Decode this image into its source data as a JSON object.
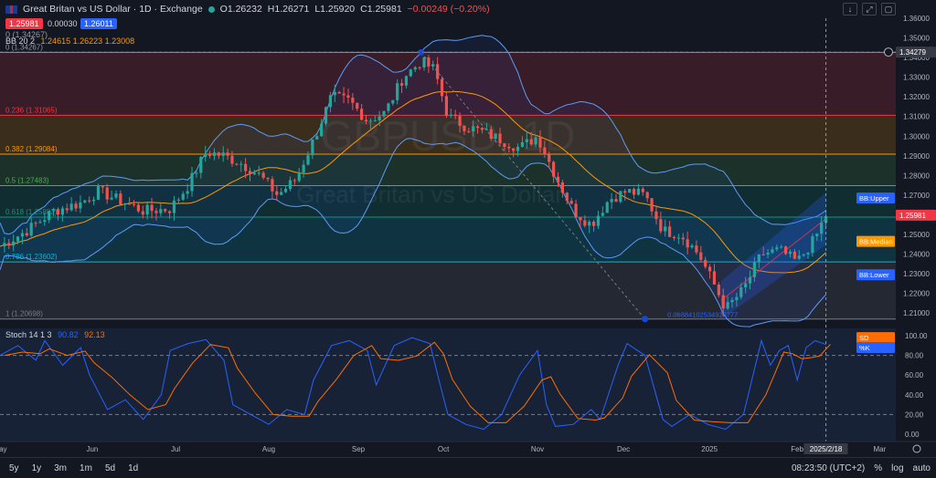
{
  "header": {
    "symbol_title": "Great Britan vs US Dollar · 1D · Exchange",
    "open": "O1.26232",
    "high": "H1.26271",
    "low": "L1.25920",
    "close": "C1.25981",
    "change": "−0.00249 (−0.20%)",
    "bid": "1.25981",
    "spread": "0.00030",
    "ask": "1.26011"
  },
  "indicators": {
    "fib_top": "0 (1.34267)",
    "bb": "BB 20 2",
    "bb_values": "1.24615  1.26223  1.23008",
    "stoch": "Stoch 14 1 3",
    "stoch_k": "90.82",
    "stoch_d": "92.13"
  },
  "watermark": {
    "symbol": "GBPUSD, 1D",
    "name": "Great Britan vs US Dollar"
  },
  "bottom": {
    "ranges": [
      "5y",
      "1y",
      "3m",
      "1m",
      "5d",
      "1d"
    ],
    "time": "08:23:50 (UTC+2)",
    "pct": "%",
    "log": "log",
    "auto": "auto"
  },
  "colors": {
    "up": "#26a69a",
    "down": "#ef5350",
    "bb_band": "#5b9cf6",
    "bb_mid": "#ff9800",
    "stoch_k": "#2962ff",
    "stoch_d": "#ff6d00"
  },
  "chart_data": {
    "type": "candlestick",
    "price_axis": {
      "ticks": [
        "1.36000",
        "1.35000",
        "1.34000",
        "1.33000",
        "1.32000",
        "1.31000",
        "1.30000",
        "1.29000",
        "1.28000",
        "1.27000",
        "1.26000",
        "1.25000",
        "1.24000",
        "1.23000",
        "1.22000",
        "1.21000"
      ],
      "ylim": [
        1.205,
        1.36
      ]
    },
    "stoch_axis": {
      "ticks": [
        "100.00",
        "80.00",
        "60.00",
        "40.00",
        "20.00",
        "0.00"
      ],
      "ylim": [
        0,
        100
      ]
    },
    "time_axis": {
      "ticks": [
        "May",
        "Jun",
        "Jul",
        "Aug",
        "Sep",
        "Oct",
        "Nov",
        "Dec",
        "2025",
        "Feb",
        "Mar"
      ],
      "cursor_label": "2025/2/18"
    },
    "price_labels": {
      "current": "1.25981",
      "cursor": "1.34279",
      "bb_upper": "BB:Upper",
      "bb_median": "BB:Median",
      "bb_lower": "BB:Lower",
      "sd": "SD",
      "k": "%K"
    },
    "fib_levels": [
      {
        "label": "0 (1.34267)",
        "value": 1.34267,
        "color": "#9598a1"
      },
      {
        "label": "0.236 (1.31065)",
        "value": 1.31065,
        "color": "#f23645"
      },
      {
        "label": "0.382 (1.29084)",
        "value": 1.29084,
        "color": "#ff9800"
      },
      {
        "label": "0.5 (1.27483)",
        "value": 1.27483,
        "color": "#4caf50"
      },
      {
        "label": "0.618 (1.25882)",
        "value": 1.25882,
        "color": "#089981"
      },
      {
        "label": "0.786 (1.23602)",
        "value": 1.23602,
        "color": "#00bcd4"
      },
      {
        "label": "1 (1.20698)",
        "value": 1.20698,
        "color": "#787b86"
      }
    ],
    "trend_line_label": "0.06884102534923777",
    "channel": {
      "start": [
        0.805,
        1.226,
        1.207
      ],
      "end": [
        0.922,
        1.271,
        1.245
      ]
    },
    "close_path": [
      [
        0.0,
        1.244
      ],
      [
        0.03,
        1.252
      ],
      [
        0.06,
        1.262
      ],
      [
        0.09,
        1.266
      ],
      [
        0.11,
        1.272
      ],
      [
        0.13,
        1.268
      ],
      [
        0.16,
        1.262
      ],
      [
        0.19,
        1.263
      ],
      [
        0.21,
        1.275
      ],
      [
        0.23,
        1.292
      ],
      [
        0.25,
        1.29
      ],
      [
        0.27,
        1.286
      ],
      [
        0.29,
        1.28
      ],
      [
        0.31,
        1.27
      ],
      [
        0.33,
        1.278
      ],
      [
        0.35,
        1.298
      ],
      [
        0.37,
        1.32
      ],
      [
        0.39,
        1.318
      ],
      [
        0.41,
        1.308
      ],
      [
        0.43,
        1.312
      ],
      [
        0.45,
        1.33
      ],
      [
        0.47,
        1.338
      ],
      [
        0.485,
        1.334
      ],
      [
        0.5,
        1.31
      ],
      [
        0.52,
        1.305
      ],
      [
        0.54,
        1.302
      ],
      [
        0.56,
        1.298
      ],
      [
        0.58,
        1.294
      ],
      [
        0.6,
        1.3
      ],
      [
        0.62,
        1.28
      ],
      [
        0.64,
        1.262
      ],
      [
        0.66,
        1.255
      ],
      [
        0.68,
        1.268
      ],
      [
        0.7,
        1.272
      ],
      [
        0.72,
        1.27
      ],
      [
        0.74,
        1.252
      ],
      [
        0.76,
        1.25
      ],
      [
        0.78,
        1.24
      ],
      [
        0.8,
        1.222
      ],
      [
        0.81,
        1.212
      ],
      [
        0.83,
        1.222
      ],
      [
        0.85,
        1.24
      ],
      [
        0.87,
        1.242
      ],
      [
        0.89,
        1.236
      ],
      [
        0.91,
        1.248
      ],
      [
        0.922,
        1.26
      ]
    ],
    "stoch_path": [
      [
        0.0,
        80
      ],
      [
        0.02,
        90
      ],
      [
        0.04,
        75
      ],
      [
        0.05,
        95
      ],
      [
        0.07,
        70
      ],
      [
        0.09,
        88
      ],
      [
        0.1,
        60
      ],
      [
        0.12,
        25
      ],
      [
        0.14,
        35
      ],
      [
        0.16,
        15
      ],
      [
        0.18,
        40
      ],
      [
        0.19,
        85
      ],
      [
        0.21,
        92
      ],
      [
        0.23,
        96
      ],
      [
        0.25,
        75
      ],
      [
        0.26,
        30
      ],
      [
        0.28,
        20
      ],
      [
        0.3,
        10
      ],
      [
        0.32,
        25
      ],
      [
        0.34,
        20
      ],
      [
        0.35,
        55
      ],
      [
        0.37,
        90
      ],
      [
        0.39,
        95
      ],
      [
        0.41,
        85
      ],
      [
        0.42,
        50
      ],
      [
        0.44,
        90
      ],
      [
        0.46,
        98
      ],
      [
        0.48,
        92
      ],
      [
        0.49,
        55
      ],
      [
        0.5,
        20
      ],
      [
        0.52,
        10
      ],
      [
        0.54,
        5
      ],
      [
        0.56,
        20
      ],
      [
        0.58,
        60
      ],
      [
        0.6,
        85
      ],
      [
        0.61,
        30
      ],
      [
        0.62,
        8
      ],
      [
        0.64,
        10
      ],
      [
        0.66,
        25
      ],
      [
        0.67,
        15
      ],
      [
        0.69,
        70
      ],
      [
        0.7,
        92
      ],
      [
        0.72,
        80
      ],
      [
        0.74,
        15
      ],
      [
        0.75,
        8
      ],
      [
        0.77,
        20
      ],
      [
        0.79,
        10
      ],
      [
        0.81,
        5
      ],
      [
        0.83,
        20
      ],
      [
        0.85,
        95
      ],
      [
        0.86,
        70
      ],
      [
        0.87,
        85
      ],
      [
        0.88,
        90
      ],
      [
        0.89,
        55
      ],
      [
        0.9,
        88
      ],
      [
        0.91,
        95
      ],
      [
        0.922,
        91
      ]
    ]
  }
}
